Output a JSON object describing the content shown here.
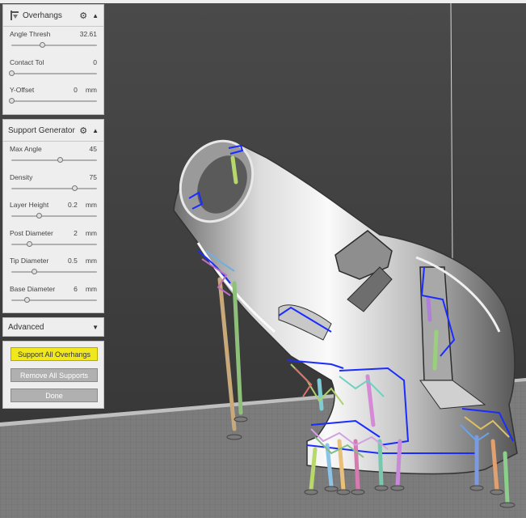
{
  "overhangs": {
    "title": "Overhangs",
    "icon": "overhang-icon",
    "sliders": [
      {
        "label": "Angle Thresh",
        "value": "32.61",
        "unit": "",
        "level": 0.36
      },
      {
        "label": "Contact Tol",
        "value": "0",
        "unit": "",
        "level": 0.0
      },
      {
        "label": "Y-Offset",
        "value": "0",
        "unit": "mm",
        "level": 0.0
      }
    ]
  },
  "support_generator": {
    "title": "Support Generator",
    "sliders": [
      {
        "label": "Max Angle",
        "value": "45",
        "unit": "",
        "level": 0.57
      },
      {
        "label": "Density",
        "value": "75",
        "unit": "",
        "level": 0.74
      },
      {
        "label": "Layer Height",
        "value": "0.2",
        "unit": "mm",
        "level": 0.33
      },
      {
        "label": "Post Diameter",
        "value": "2",
        "unit": "mm",
        "level": 0.21
      },
      {
        "label": "Tip Diameter",
        "value": "0.5",
        "unit": "mm",
        "level": 0.27
      },
      {
        "label": "Base Diameter",
        "value": "6",
        "unit": "mm",
        "level": 0.18
      }
    ]
  },
  "advanced": {
    "label": "Advanced"
  },
  "actions": {
    "support_all": "Support All Overhangs",
    "remove_all": "Remove All Supports",
    "done": "Done"
  },
  "colors": {
    "accent_yellow": "#f0e81c",
    "button_gray": "#b0b0b0",
    "support_blue": "#1a2cff",
    "background": "#3b3b3b",
    "floor": "#808080"
  },
  "icons": [
    "overhang-icon",
    "gear-icon",
    "collapse-arrow-icon",
    "expand-arrow-icon"
  ]
}
